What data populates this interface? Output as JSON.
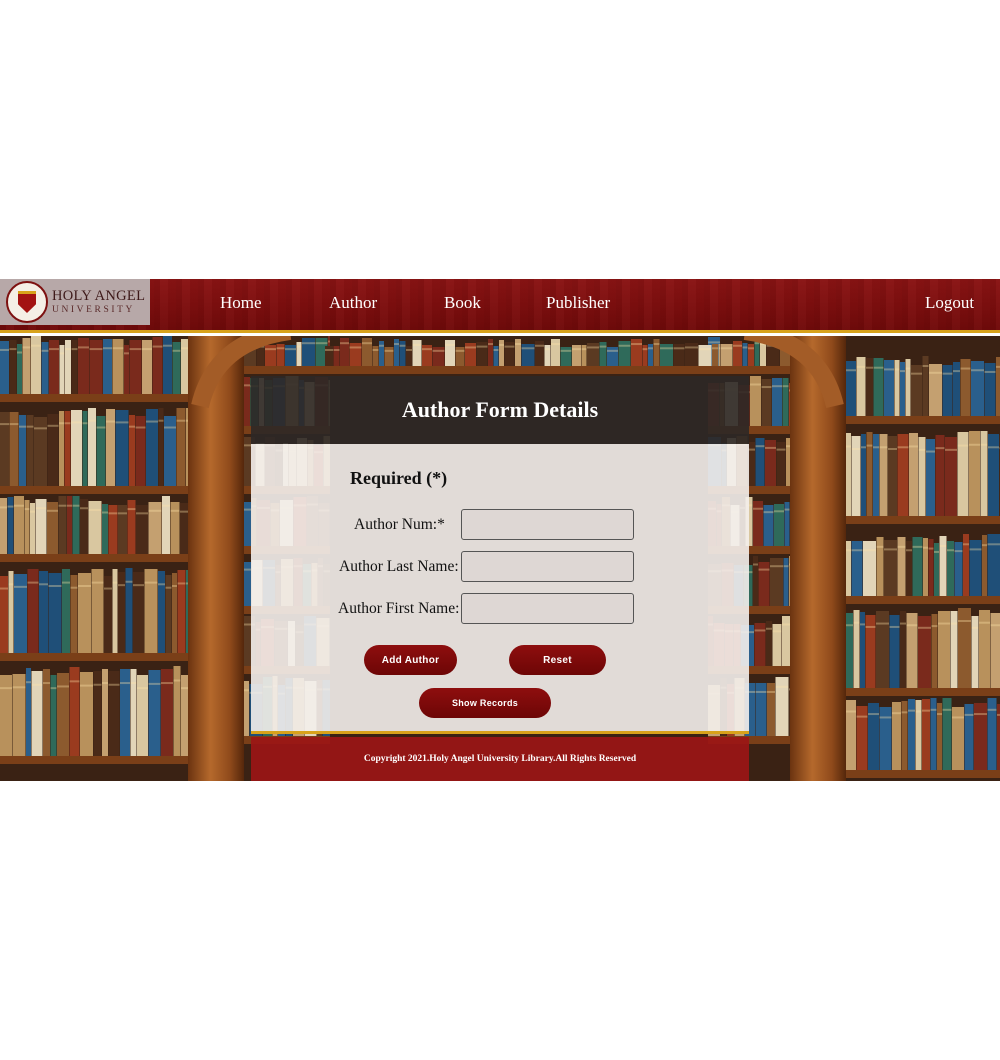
{
  "brand": {
    "line1": "HOLY ANGEL",
    "line2": "UNIVERSITY",
    "seal_icon": "university-seal-icon"
  },
  "nav": {
    "items": [
      {
        "label": "Home"
      },
      {
        "label": "Author"
      },
      {
        "label": "Book"
      },
      {
        "label": "Publisher"
      }
    ],
    "logout": "Logout"
  },
  "form": {
    "title": "Author Form Details",
    "required_note": "Required (*)",
    "fields": [
      {
        "label": "Author Num:*",
        "value": ""
      },
      {
        "label": "Author Last Name:",
        "value": ""
      },
      {
        "label": "Author First Name:",
        "value": ""
      }
    ],
    "buttons": {
      "add": "Add Author",
      "reset": "Reset",
      "show": "Show Records"
    }
  },
  "footer": {
    "copyright": "Copyright 2021.Holy Angel University Library.All Rights Reserved"
  },
  "colors": {
    "primary": "#7d0e0e",
    "accent": "#d8a21b",
    "panel_head": "#2d2826"
  }
}
